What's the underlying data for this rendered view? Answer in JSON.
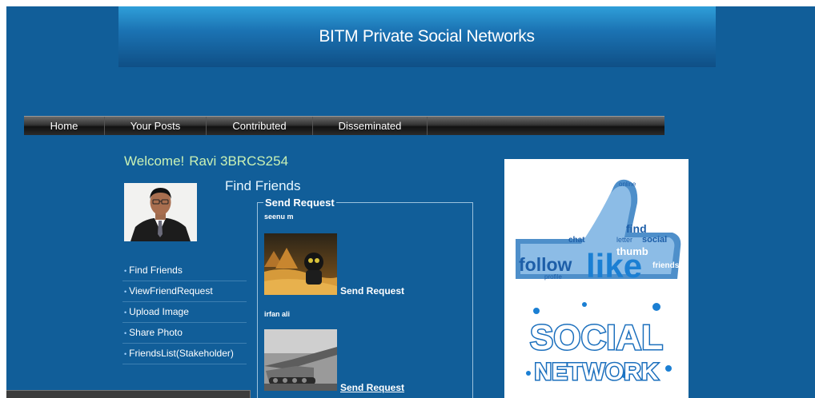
{
  "banner": {
    "title": "BITM Private Social Networks"
  },
  "nav": {
    "items": [
      "Home",
      "Your Posts",
      "Contributed",
      "Disseminated"
    ]
  },
  "welcome": {
    "greeting": "Welcome!",
    "user": "Ravi 3BRCS254"
  },
  "sidebar": {
    "items": [
      {
        "label": "Find Friends"
      },
      {
        "label": "ViewFriendRequest"
      },
      {
        "label": "Upload Image"
      },
      {
        "label": "Share Photo"
      },
      {
        "label": "FriendsList(Stakeholder)"
      }
    ]
  },
  "find_friends": {
    "title": "Find Friends",
    "legend": "Send Request",
    "friends": [
      {
        "name": "seenu m",
        "action": "Send Request"
      },
      {
        "name": "irfan ali",
        "action": "Send Request"
      }
    ]
  },
  "right_image": {
    "like_words": [
      "follow",
      "like",
      "find",
      "thumb",
      "social",
      "friends",
      "letter",
      "online",
      "chat",
      "profile"
    ],
    "social_word": "SOCIAL",
    "network_word": "NETWORK"
  },
  "colors": {
    "page_bg": "#115e99",
    "welcome_text": "#c9f1b5",
    "nav_bg": "#222222"
  }
}
